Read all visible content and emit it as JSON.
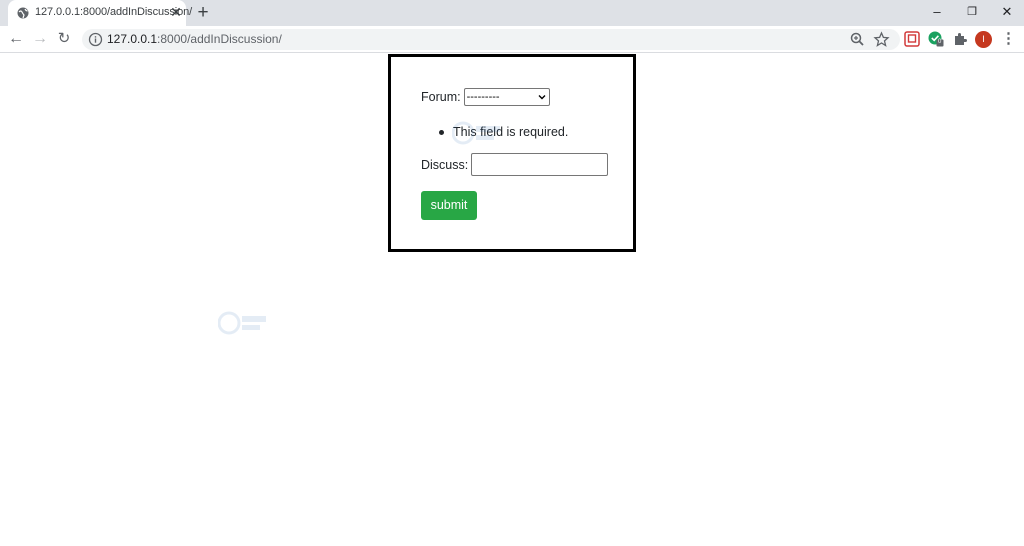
{
  "browser": {
    "tab_title": "127.0.0.1:8000/addInDiscussion/",
    "tab_close": "✕",
    "new_tab": "+",
    "url_host": "127.0.0.1",
    "url_rest": ":8000/addInDiscussion/",
    "profile_initial": "I",
    "extension_badge": "0",
    "window_controls": {
      "minimize": "–",
      "restore": "❐",
      "close": "✕"
    },
    "nav": {
      "back": "←",
      "forward": "→",
      "reload": "↻"
    },
    "menu": "⋮",
    "icons": {
      "zoom": "zoom-icon",
      "bookmark": "star-icon",
      "extensions": "puzzle-icon"
    }
  },
  "form": {
    "forum_label": "Forum:",
    "forum_selected": "---------",
    "error_message": "This field is required.",
    "discuss_label": "Discuss:",
    "discuss_value": "",
    "submit_label": "submit"
  },
  "colors": {
    "submit_bg": "#28a745",
    "border": "#000000",
    "tabstrip": "#dee1e6",
    "avatar": "#c5381f"
  }
}
